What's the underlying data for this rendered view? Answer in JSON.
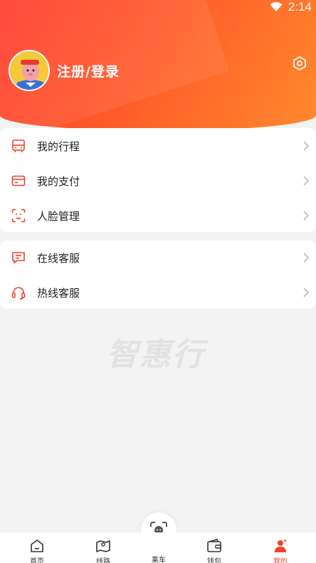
{
  "status_bar": {
    "time": "2:14"
  },
  "profile": {
    "login_label": "注册/登录"
  },
  "menu_group_1": [
    {
      "label": "我的行程",
      "icon": "bus-icon"
    },
    {
      "label": "我的支付",
      "icon": "card-icon"
    },
    {
      "label": "人脸管理",
      "icon": "face-scan-icon"
    }
  ],
  "menu_group_2": [
    {
      "label": "在线客服",
      "icon": "chat-icon"
    },
    {
      "label": "热线客服",
      "icon": "headset-icon"
    }
  ],
  "watermark": "智惠行",
  "bottom_nav": [
    {
      "label": "首页",
      "icon": "home-icon"
    },
    {
      "label": "线路",
      "icon": "map-icon"
    },
    {
      "label": "乘车",
      "icon": "scan-face-icon"
    },
    {
      "label": "钱包",
      "icon": "wallet-icon"
    },
    {
      "label": "我的",
      "icon": "user-icon",
      "active": true
    }
  ],
  "colors": {
    "accent": "#f04128",
    "header_start": "#ff3b2c",
    "header_end": "#ff8a2c"
  }
}
